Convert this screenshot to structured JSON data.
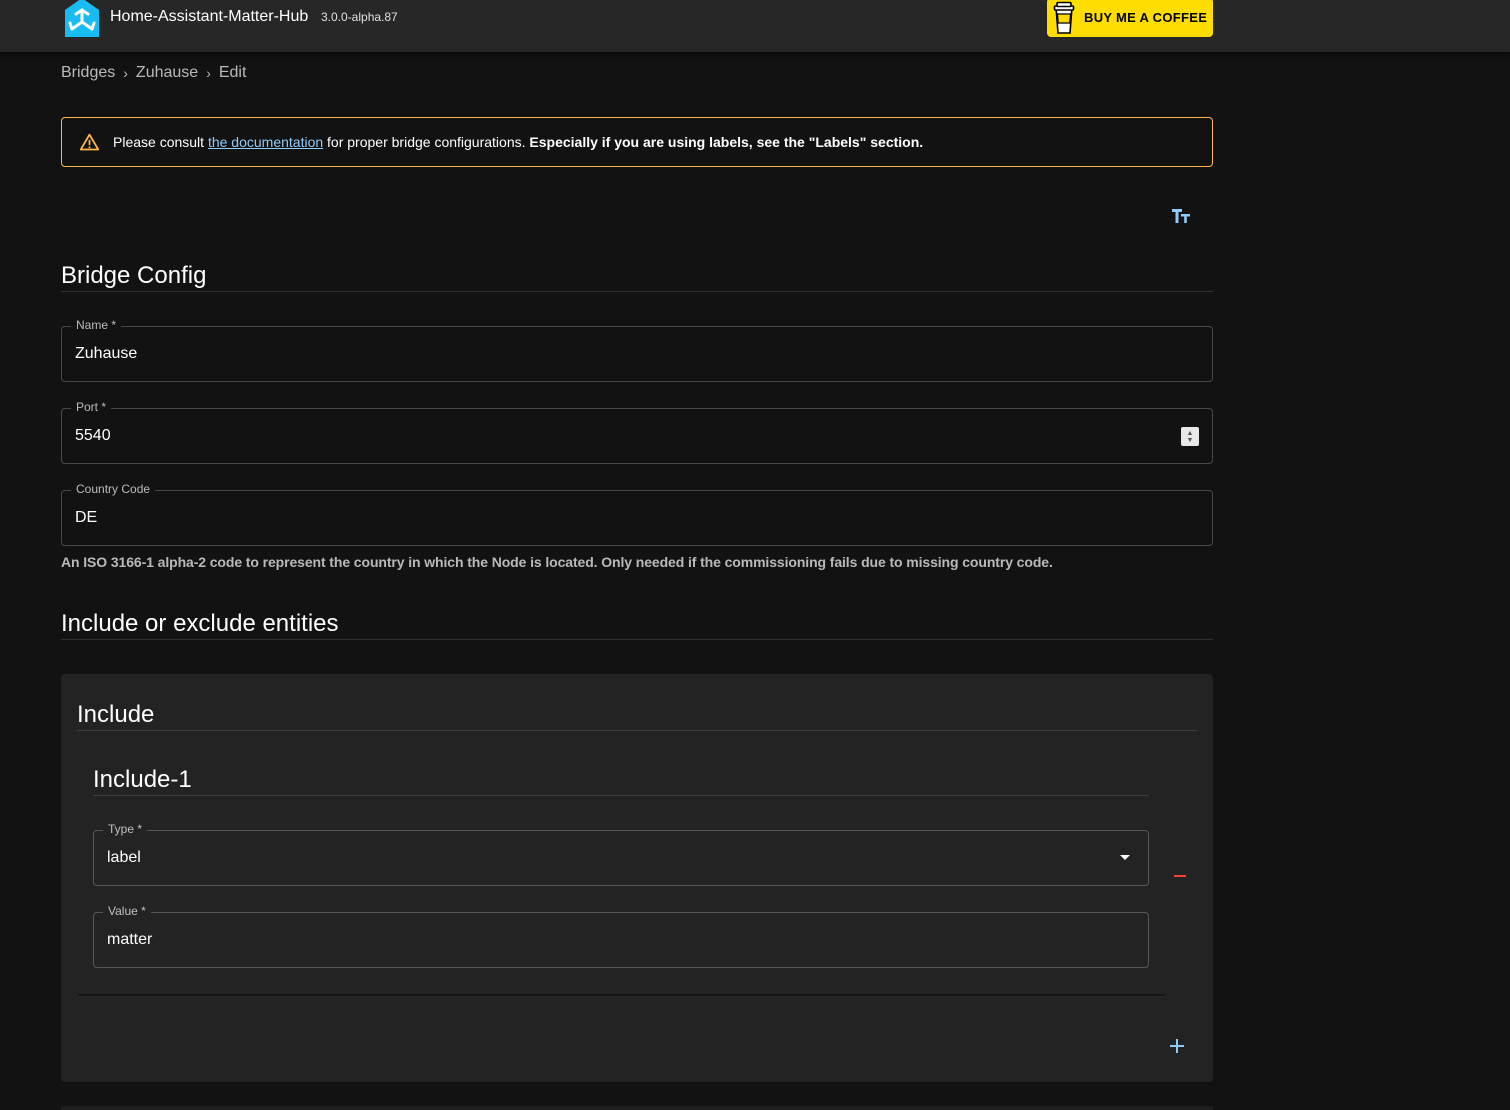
{
  "header": {
    "title": "Home-Assistant-Matter-Hub",
    "version": "3.0.0-alpha.87",
    "coffee_label": "BUY ME A COFFEE",
    "logo_icon": "matter-hub-logo-icon",
    "coffee_icon": "coffee-cup-icon"
  },
  "breadcrumb": {
    "items": [
      "Bridges",
      "Zuhause",
      "Edit"
    ],
    "separator": "›"
  },
  "alert": {
    "icon": "warning-icon",
    "prefix": "Please consult ",
    "link_text": "the documentation",
    "middle": " for proper bridge configurations. ",
    "bold_text": "Especially if you are using labels, see the \"Labels\" section."
  },
  "toolbar": {
    "text_toggle_icon": "format-size-icon",
    "text_toggle_glyph": "Tт"
  },
  "bridge_config": {
    "title": "Bridge Config",
    "name": {
      "label": "Name *",
      "value": "Zuhause"
    },
    "port": {
      "label": "Port *",
      "value": "5540"
    },
    "country_code": {
      "label": "Country Code",
      "value": "DE",
      "helper": "An ISO 3166-1 alpha-2 code to represent the country in which the Node is located. Only needed if the commissioning fails due to missing country code."
    }
  },
  "filter": {
    "title": "Include or exclude entities",
    "include": {
      "title": "Include",
      "items": [
        {
          "title": "Include-1",
          "type": {
            "label": "Type *",
            "value": "label"
          },
          "value": {
            "label": "Value *",
            "value": "matter"
          }
        }
      ]
    }
  },
  "colors": {
    "background": "#121212",
    "appbar": "#272727",
    "paper": "#232323",
    "coffee": "#ffdd00",
    "warning": "#ffb74d",
    "link": "#90caf9",
    "remove": "#f44336"
  }
}
